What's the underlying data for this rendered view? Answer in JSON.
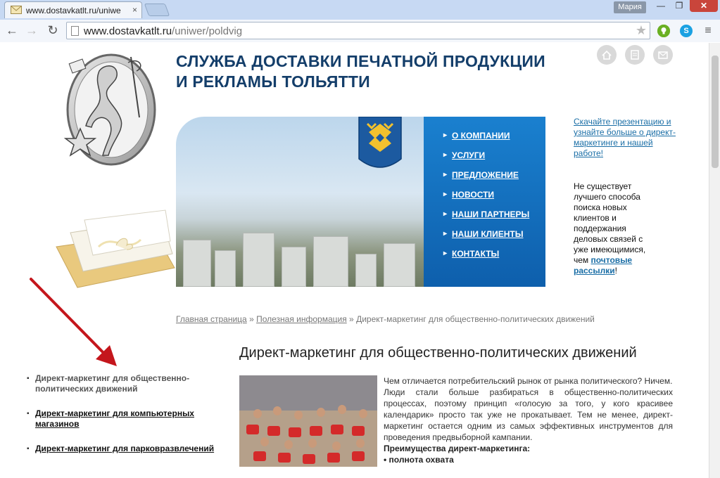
{
  "browser": {
    "tab_title": "www.dostavkatlt.ru/uniwe",
    "tab_close": "×",
    "profile": "Мария",
    "url_host": "www.dostavkatlt.ru",
    "url_path": "/uniwer/poldvig",
    "win_minimize": "—",
    "win_maximize": "❐",
    "win_close": "✕",
    "back": "←",
    "forward": "→",
    "reload": "↻",
    "star": "★",
    "menu": "≡",
    "ext_skype": "S"
  },
  "site": {
    "title_line1": "СЛУЖБА ДОСТАВКИ ПЕЧАТНОЙ ПРОДУКЦИИ",
    "title_line2": "И РЕКЛАМЫ ТОЛЬЯТТИ",
    "header_icons": [
      "home-icon",
      "sitemap-icon",
      "mail-icon"
    ]
  },
  "nav": {
    "items": [
      {
        "label": "О КОМПАНИИ"
      },
      {
        "label": "УСЛУГИ"
      },
      {
        "label": "ПРЕДЛОЖЕНИЕ"
      },
      {
        "label": "НОВОСТИ"
      },
      {
        "label": "НАШИ ПАРТНЕРЫ"
      },
      {
        "label": "НАШИ КЛИЕНТЫ"
      },
      {
        "label": "КОНТАКТЫ"
      }
    ]
  },
  "promo": {
    "link_text": "Скачайте презентацию и узнайте больше о директ-маркетинге и нашей работе!",
    "text_before": "Не существует лучшего способа поиска новых клиентов и поддержания деловых связей с уже имеющимися, чем ",
    "text_link": "почтовые рассылки",
    "text_after": "!"
  },
  "breadcrumb": {
    "home": "Главная страница",
    "sep1": " » ",
    "section": "Полезная информация",
    "sep2": " » ",
    "current": "Директ-маркетинг для общественно-политических движений"
  },
  "article": {
    "title": "Директ-маркетинг для общественно-политических движений",
    "p1": "Чем отличается потребительский рынок от рынка политического? Ничем.",
    "p2": "Люди стали больше разбираться в общественно-политических процессах, поэтому принцип «голосую за того, у кого красивее календарик» просто так уже не прокатывает. Тем не менее, директ-маркетинг остается одним из самых эффективных инструментов для проведения предвыборной кампании.",
    "advantages_title": "Преимущества директ-маркетинга:",
    "advantage1": "• полнота охвата"
  },
  "side_menu": {
    "items": [
      {
        "label": "Директ-маркетинг для общественно-политических движений"
      },
      {
        "label": "Директ-маркетинг для компьютерных магазинов"
      },
      {
        "label": "Директ-маркетинг для парковразвлечений"
      }
    ]
  }
}
